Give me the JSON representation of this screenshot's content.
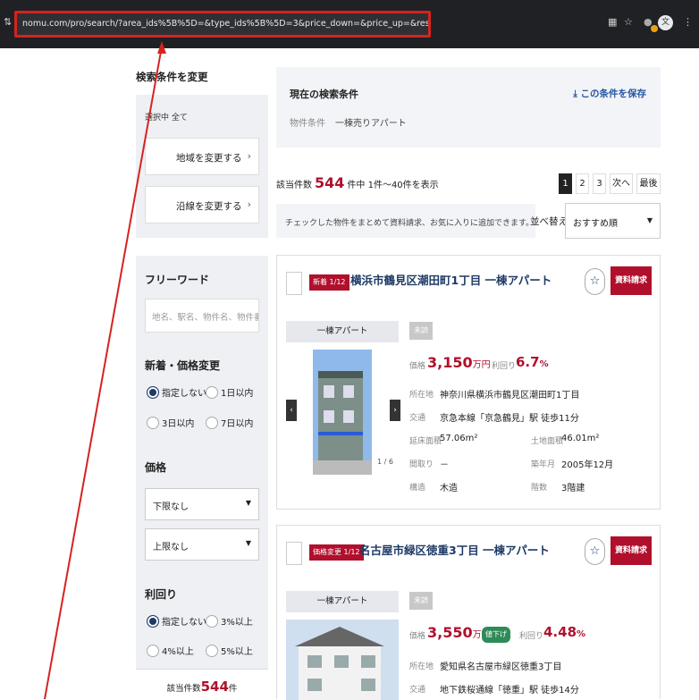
{
  "browser": {
    "url": "nomu.com/pro/search/?area_ids%5B%5D=&type_ids%5B%5D=3&price_down=&price_up=&reserved_yield=&fw=&amc=A",
    "profile_initial": "文",
    "badge": "1"
  },
  "sidebar": {
    "title": "検索条件を変更",
    "selected_label": "選択中",
    "selected_value": "全て",
    "region_button": "地域を変更する",
    "line_button": "沿線を変更する",
    "freeword_head": "フリーワード",
    "freeword_placeholder": "地名、駅名、物件名、物件番号",
    "new_head": "新着・価格変更",
    "new_options": [
      "指定しない",
      "1日以内",
      "3日以内",
      "7日以内"
    ],
    "price_head": "価格",
    "price_min": "下限なし",
    "price_max": "上限なし",
    "yield_head": "利回り",
    "yield_options": [
      "指定しない",
      "3%以上",
      "4%以上",
      "5%以上"
    ],
    "count_prefix": "該当件数",
    "count_value": "544",
    "count_suffix": "件"
  },
  "conditions": {
    "title": "現在の検索条件",
    "key": "物件条件",
    "value": "一棟売りアパート",
    "save": "この条件を保存"
  },
  "results": {
    "prefix": "該当件数",
    "count": "544",
    "suffix": "件中 1件〜40件を表示",
    "pages": [
      "1",
      "2",
      "3",
      "次へ",
      "最後"
    ],
    "check_note": "チェックした物件をまとめて資料請求、お気に入りに追加できます。",
    "sort_label": "並べ替え",
    "sort_value": "おすすめ順"
  },
  "listings": [
    {
      "tag": "新着 1/12",
      "title": "横浜市鶴見区潮田町1丁目 一棟アパート",
      "request": "資料請求",
      "type": "一棟アパート",
      "unread": "未読",
      "photo_index": "1 / 6",
      "price_label": "価格",
      "price": "3,150",
      "price_unit": "万円",
      "yield_label": "利回り",
      "yield": "6.7",
      "yield_unit": "%",
      "address_label": "所在地",
      "address": "神奈川県横浜市鶴見区潮田町1丁目",
      "access_label": "交通",
      "access": "京急本線「京急鶴見」駅 徒歩11分",
      "floor_area_label": "延床面積",
      "floor_area": "57.06m²",
      "land_area_label": "土地面積",
      "land_area": "46.01m²",
      "layout_label": "間取り",
      "layout": "－",
      "built_label": "築年月",
      "built": "2005年12月",
      "structure_label": "構造",
      "structure": "木造",
      "floors_label": "階数",
      "floors": "3階建"
    },
    {
      "tag": "価格変更 1/12",
      "title": "名古屋市緑区徳重3丁目 一棟アパート",
      "request": "資料請求",
      "type": "一棟アパート",
      "unread": "未読",
      "price_label": "価格",
      "price": "3,550",
      "price_unit": "万円",
      "price_badge": "値下げ",
      "yield_label": "利回り",
      "yield": "4.48",
      "yield_unit": "%",
      "address_label": "所在地",
      "address": "愛知県名古屋市緑区徳重3丁目",
      "access_label": "交通",
      "access": "地下鉄桜通線「徳重」駅 徒歩14分"
    }
  ],
  "colors": {
    "accent_red": "#b0102c",
    "navy": "#1e3a66",
    "annotation_red": "#d6231f"
  }
}
